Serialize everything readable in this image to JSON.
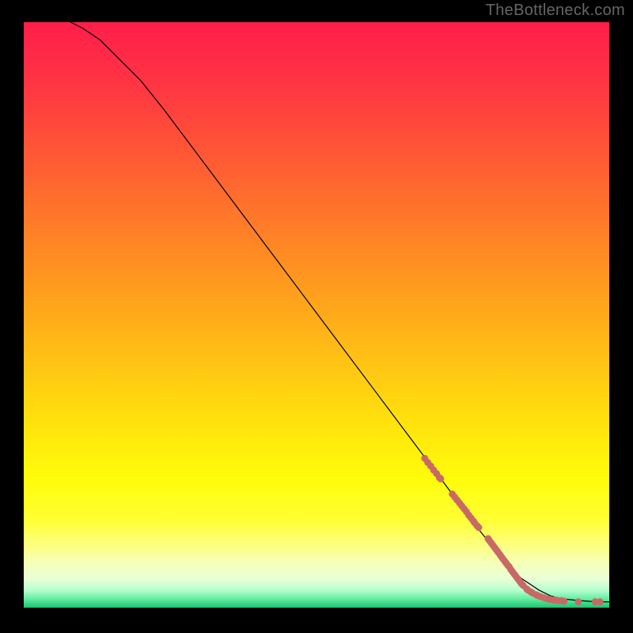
{
  "watermark": "TheBottleneck.com",
  "chart_data": {
    "type": "line",
    "title": "",
    "xlabel": "",
    "ylabel": "",
    "xlim": [
      0,
      100
    ],
    "ylim": [
      0,
      100
    ],
    "grid": false,
    "curve_xy": [
      [
        8,
        100
      ],
      [
        10,
        99
      ],
      [
        13,
        97
      ],
      [
        16,
        94
      ],
      [
        20,
        90
      ],
      [
        24,
        85
      ],
      [
        30,
        77
      ],
      [
        36,
        69
      ],
      [
        42,
        61
      ],
      [
        48,
        53
      ],
      [
        54,
        45
      ],
      [
        60,
        37
      ],
      [
        66,
        29
      ],
      [
        72,
        21
      ],
      [
        78,
        13
      ],
      [
        82,
        8
      ],
      [
        85,
        5
      ],
      [
        88,
        3
      ],
      [
        90,
        2
      ],
      [
        92,
        1.5
      ],
      [
        95,
        1.2
      ],
      [
        98,
        1
      ],
      [
        100,
        1
      ]
    ],
    "dots_xy": [
      [
        68.5,
        25.5
      ],
      [
        69.0,
        24.8
      ],
      [
        69.5,
        24.2
      ],
      [
        70.0,
        23.5
      ],
      [
        70.5,
        22.9
      ],
      [
        71.0,
        22.2
      ],
      [
        71.2,
        22.0
      ],
      [
        73.2,
        19.4
      ],
      [
        73.6,
        18.9
      ],
      [
        74.0,
        18.4
      ],
      [
        74.4,
        17.9
      ],
      [
        74.8,
        17.4
      ],
      [
        75.2,
        16.9
      ],
      [
        75.6,
        16.4
      ],
      [
        76.0,
        15.8
      ],
      [
        76.4,
        15.3
      ],
      [
        76.8,
        14.8
      ],
      [
        77.0,
        14.5
      ],
      [
        77.4,
        14.0
      ],
      [
        77.7,
        13.7
      ],
      [
        79.3,
        11.8
      ],
      [
        79.5,
        11.5
      ],
      [
        79.8,
        11.1
      ],
      [
        80.1,
        10.7
      ],
      [
        80.4,
        10.3
      ],
      [
        80.7,
        9.9
      ],
      [
        81.0,
        9.5
      ],
      [
        81.3,
        9.1
      ],
      [
        81.5,
        8.8
      ],
      [
        81.8,
        8.4
      ],
      [
        82.1,
        8.0
      ],
      [
        82.4,
        7.6
      ],
      [
        82.7,
        7.2
      ],
      [
        82.9,
        7.0
      ],
      [
        83.2,
        6.5
      ],
      [
        83.5,
        6.1
      ],
      [
        83.8,
        5.7
      ],
      [
        84.1,
        5.3
      ],
      [
        84.4,
        4.9
      ],
      [
        84.7,
        4.5
      ],
      [
        85.0,
        4.1
      ],
      [
        85.3,
        3.8
      ],
      [
        85.9,
        3.2
      ],
      [
        86.1,
        3.0
      ],
      [
        86.6,
        2.7
      ],
      [
        86.9,
        2.5
      ],
      [
        87.5,
        2.2
      ],
      [
        87.7,
        2.1
      ],
      [
        88.2,
        1.9
      ],
      [
        88.8,
        1.7
      ],
      [
        89.4,
        1.5
      ],
      [
        89.9,
        1.4
      ],
      [
        90.5,
        1.3
      ],
      [
        90.9,
        1.3
      ],
      [
        91.3,
        1.2
      ],
      [
        91.8,
        1.2
      ],
      [
        92.3,
        1.1
      ],
      [
        94.7,
        1.0
      ],
      [
        97.6,
        1.0
      ],
      [
        98.4,
        1.0
      ]
    ],
    "dot_color": "#c96966",
    "gradient_stops": [
      {
        "y": 100,
        "color": "#ff1e4a"
      },
      {
        "y": 90,
        "color": "#ff3344"
      },
      {
        "y": 80,
        "color": "#ff5038"
      },
      {
        "y": 70,
        "color": "#ff6e2d"
      },
      {
        "y": 60,
        "color": "#ff8c23"
      },
      {
        "y": 50,
        "color": "#ffaa1a"
      },
      {
        "y": 40,
        "color": "#ffc912"
      },
      {
        "y": 30,
        "color": "#ffe70c"
      },
      {
        "y": 22,
        "color": "#fffc0a"
      },
      {
        "y": 15,
        "color": "#ffff33"
      },
      {
        "y": 11,
        "color": "#fcff7a"
      },
      {
        "y": 8,
        "color": "#f7ffb3"
      },
      {
        "y": 5,
        "color": "#eaffd6"
      },
      {
        "y": 3,
        "color": "#b8ffcf"
      },
      {
        "y": 1.5,
        "color": "#63eda0"
      },
      {
        "y": 0,
        "color": "#18c46f"
      }
    ]
  }
}
